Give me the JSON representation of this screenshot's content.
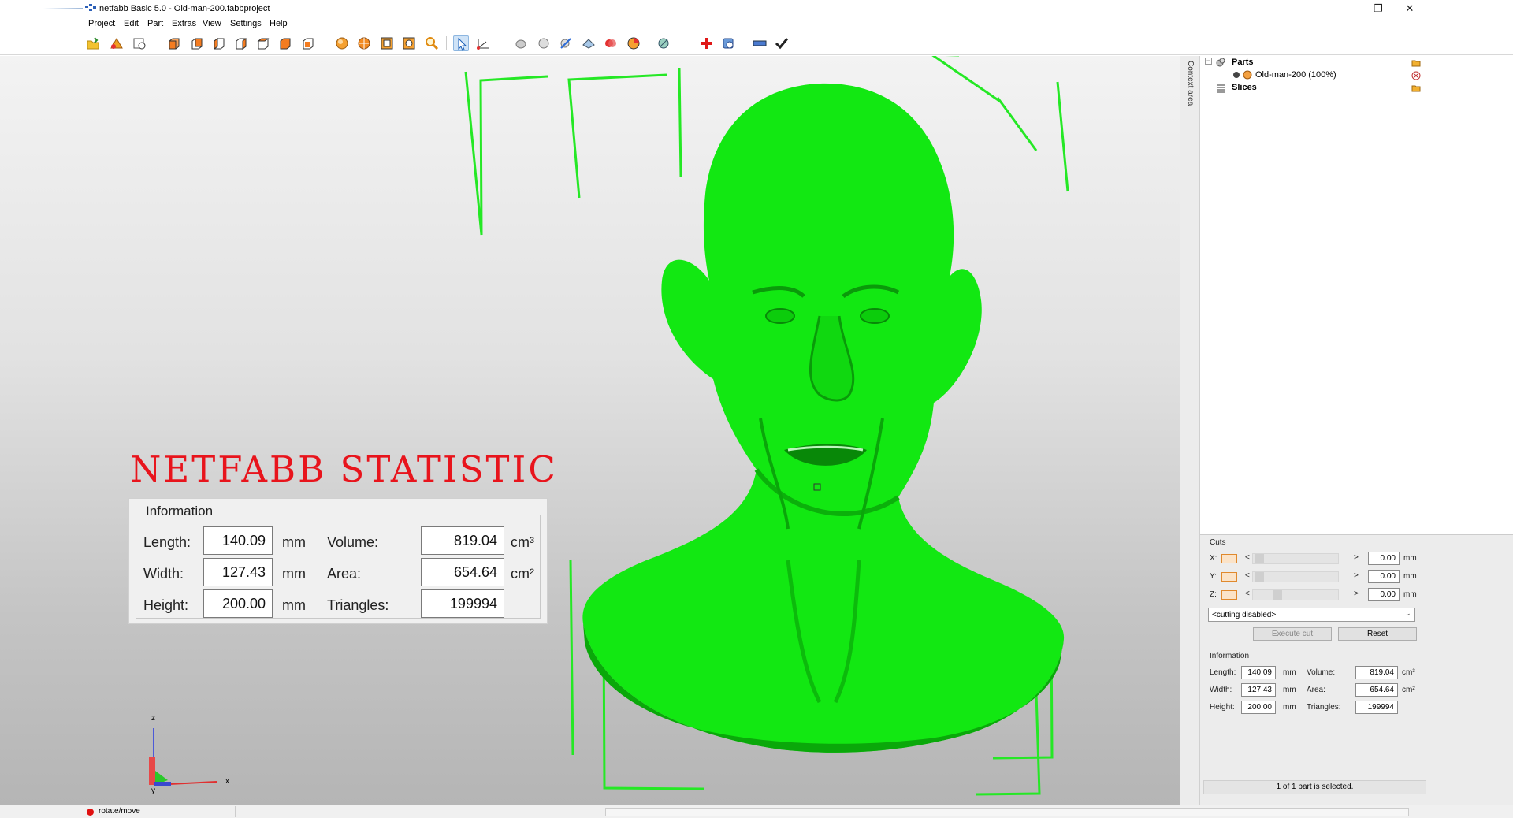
{
  "window": {
    "title": "netfabb Basic 5.0 - Old-man-200.fabbproject",
    "minimize": "—",
    "maximize": "❐",
    "close": "✕"
  },
  "menu": [
    "Project",
    "Edit",
    "Part",
    "Extras",
    "View",
    "Settings",
    "Help"
  ],
  "toolbar": {
    "icons": [
      "open-icon",
      "add-part-icon",
      "settings-icon",
      "view-front-icon",
      "view-back-icon",
      "view-left-icon",
      "view-right-icon",
      "view-top-icon",
      "view-bottom-icon",
      "view-iso-icon",
      "rotate-icon",
      "sphere-icon",
      "zoom-box-icon",
      "zoom-parts-icon",
      "zoom-icon",
      "select-icon",
      "measure-icon",
      "shading-icon",
      "sphere-view-icon",
      "cut-icon",
      "paint-icon",
      "color-icon",
      "pie-icon",
      "viewpoint-icon",
      "repair-icon",
      "orbit-icon",
      "ruler-icon",
      "apply-icon"
    ]
  },
  "viewport": {
    "overlay_title": "NETFABB STATISTIC",
    "info_legend": "Information",
    "length_label": "Length:",
    "width_label": "Width:",
    "height_label": "Height:",
    "volume_label": "Volume:",
    "area_label": "Area:",
    "triangles_label": "Triangles:",
    "length": "140.09",
    "width": "127.43",
    "height": "200.00",
    "volume": "819.04",
    "area": "654.64",
    "triangles": "199994",
    "unit_mm": "mm",
    "unit_cm3": "cm³",
    "unit_cm2": "cm²",
    "axis_z": "z",
    "axis_x": "x",
    "axis_y": "y",
    "model_color": "#12e812",
    "bracket_color": "#25e825"
  },
  "context_area_label": "Context area",
  "tree": {
    "parts_label": "Parts",
    "part_name": "Old-man-200 (100%)",
    "slices_label": "Slices"
  },
  "cuts": {
    "legend": "Cuts",
    "x_label": "X:",
    "y_label": "Y:",
    "z_label": "Z:",
    "x_value": "0.00",
    "y_value": "0.00",
    "z_value": "0.00",
    "unit": "mm",
    "mode": "<cutting disabled>",
    "execute_label": "Execute cut",
    "reset_label": "Reset",
    "left_arrow": "<",
    "right_arrow": ">"
  },
  "info_panel": {
    "legend": "Information",
    "length_label": "Length:",
    "width_label": "Width:",
    "height_label": "Height:",
    "volume_label": "Volume:",
    "area_label": "Area:",
    "triangles_label": "Triangles:",
    "length": "140.09",
    "width": "127.43",
    "height": "200.00",
    "volume": "819.04",
    "area": "654.64",
    "triangles": "199994",
    "unit_mm": "mm",
    "unit_cm3": "cm³",
    "unit_cm2": "cm²",
    "selection_status": "1 of 1 part is selected."
  },
  "statusbar": {
    "mode": "rotate/move"
  }
}
